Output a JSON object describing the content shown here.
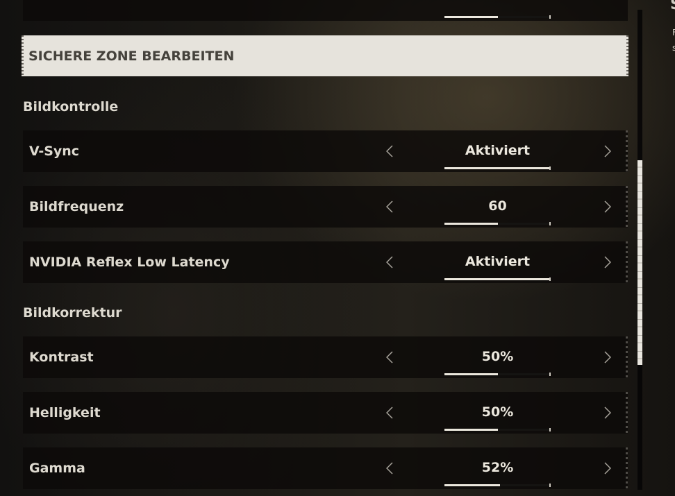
{
  "safe_zone_button": {
    "label": "SICHERE ZONE BEARBEITEN"
  },
  "sections": [
    {
      "title": "Bildkontrolle",
      "settings": [
        {
          "label": "V-Sync",
          "value": "Aktiviert",
          "level": 1.0
        },
        {
          "label": "Bildfrequenz",
          "value": "60",
          "level": 0.5
        },
        {
          "label": "NVIDIA Reflex Low Latency",
          "value": "Aktiviert",
          "level": 1.0
        }
      ]
    },
    {
      "title": "Bildkorrektur",
      "settings": [
        {
          "label": "Kontrast",
          "value": "50%",
          "level": 0.5
        },
        {
          "label": "Helligkeit",
          "value": "50%",
          "level": 0.5
        },
        {
          "label": "Gamma",
          "value": "52%",
          "level": 0.52
        }
      ]
    }
  ],
  "top_partial_row": {
    "level": 0.5
  },
  "scrollbar": {
    "position": 0.45
  },
  "right_panel": {
    "title": "S",
    "line1": "F",
    "line2": "s"
  },
  "colors": {
    "accent": "#ece8de",
    "button_bg": "#e6e3dc",
    "row_bg": "#0c0a08"
  },
  "icons": {
    "left": "chevron-left-icon",
    "right": "chevron-right-icon"
  }
}
